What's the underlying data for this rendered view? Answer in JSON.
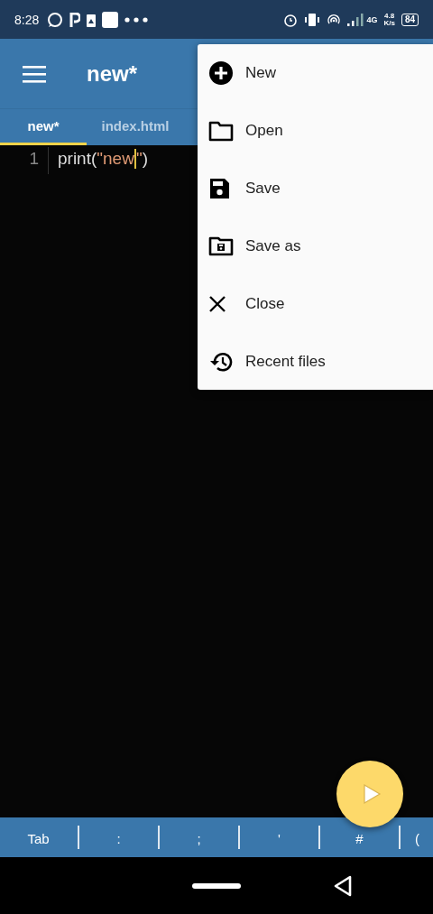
{
  "status_bar": {
    "time": "8:28",
    "network": "4G",
    "speed_value": "4.8",
    "speed_unit": "K/s",
    "battery": "84"
  },
  "app_bar": {
    "title": "new*"
  },
  "tabs": [
    {
      "label": "new*",
      "selected": true
    },
    {
      "label": "index.html",
      "selected": false
    }
  ],
  "editor": {
    "lines": [
      {
        "number": "1",
        "tokens": [
          {
            "kind": "plain",
            "text": "print("
          },
          {
            "kind": "string",
            "text": "\"new"
          },
          {
            "kind": "cursor"
          },
          {
            "kind": "string",
            "text": "\""
          },
          {
            "kind": "plain",
            "text": ")"
          }
        ]
      }
    ]
  },
  "menu": [
    {
      "kind": "new",
      "label": "New"
    },
    {
      "kind": "open",
      "label": "Open"
    },
    {
      "kind": "save",
      "label": "Save"
    },
    {
      "kind": "save_as",
      "label": "Save as"
    },
    {
      "kind": "close",
      "label": "Close"
    },
    {
      "kind": "recent",
      "label": "Recent files"
    }
  ],
  "keys": [
    "Tab",
    ":",
    ";",
    "'",
    "#",
    "("
  ]
}
